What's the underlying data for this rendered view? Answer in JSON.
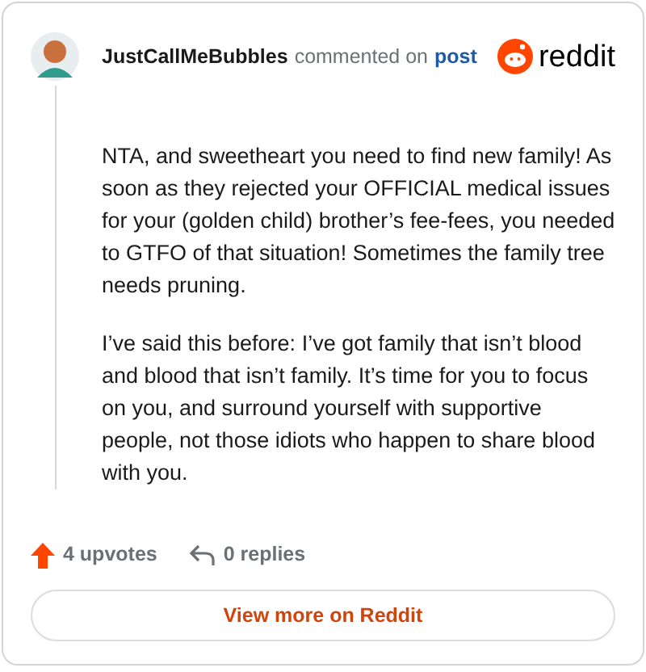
{
  "header": {
    "username": "JustCallMeBubbles",
    "action": "commented on",
    "link": "post",
    "brand": "reddit"
  },
  "comment": {
    "paragraphs": [
      "NTA, and sweetheart you need to find new family! As soon as they rejected your OFFICIAL medical issues for your (golden child) brother’s fee-fees, you needed to GTFO of that situation! Sometimes the family tree needs pruning.",
      "I’ve said this before: I’ve got family that isn’t blood and blood that isn’t family. It’s time for you to focus on you, and surround yourself with supportive people, not those idiots who happen to share blood with you."
    ]
  },
  "stats": {
    "upvotes": "4 upvotes",
    "replies": "0 replies"
  },
  "button": {
    "label": "View more on Reddit"
  }
}
